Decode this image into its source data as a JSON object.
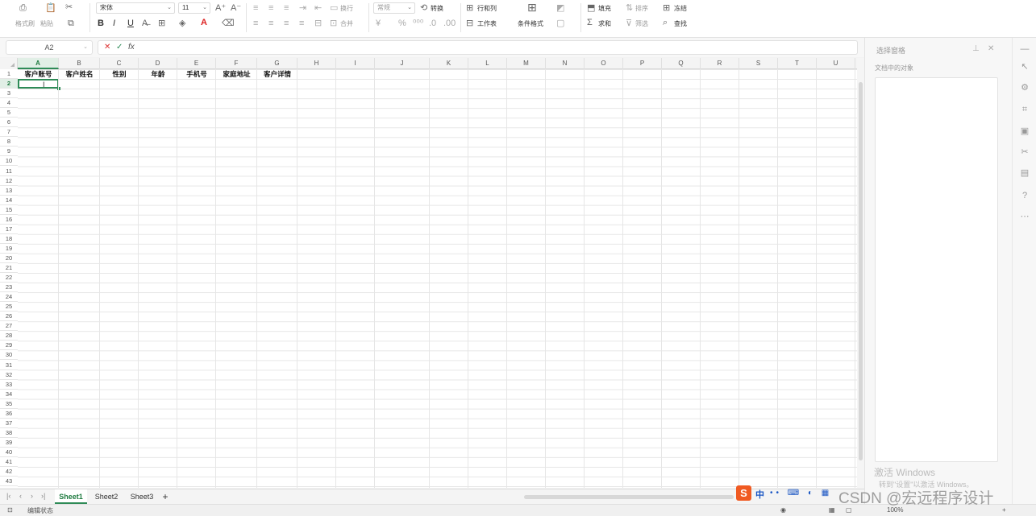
{
  "ribbon": {
    "clipboard": {
      "format_painter": "格式刷",
      "paste": "粘贴"
    },
    "font": {
      "name": "宋体",
      "size": "11",
      "bold": "B",
      "italic": "I",
      "underline": "U"
    },
    "alignment": {
      "wrap": "换行",
      "merge": "合并"
    },
    "number": {
      "format": "常规",
      "convert": "转换"
    },
    "cells": {
      "row_col": "行和列",
      "worksheet": "工作表",
      "conditional_format": "条件格式"
    },
    "editing": {
      "fill": "填充",
      "sort": "排序",
      "freeze": "冻结",
      "sum": "求和",
      "filter": "筛选",
      "find": "查找"
    }
  },
  "formula_bar": {
    "cell_ref": "A2",
    "fx": "fx",
    "cancel": "✕",
    "confirm": "✓"
  },
  "columns": [
    "A",
    "B",
    "C",
    "D",
    "E",
    "F",
    "G",
    "H",
    "I",
    "J",
    "K",
    "L",
    "M",
    "N",
    "O",
    "P",
    "Q",
    "R",
    "S",
    "T",
    "U"
  ],
  "rows": [
    "1",
    "2",
    "3",
    "4",
    "5",
    "6",
    "7",
    "8",
    "9",
    "10",
    "11",
    "12",
    "13",
    "14",
    "15",
    "16",
    "17",
    "18",
    "19",
    "20",
    "21",
    "22",
    "23",
    "24",
    "25",
    "26",
    "27",
    "28",
    "29",
    "30",
    "31",
    "32",
    "33",
    "34",
    "35",
    "36",
    "37",
    "38",
    "39",
    "40",
    "41",
    "42",
    "43"
  ],
  "header_row": [
    "客户账号",
    "客户姓名",
    "性别",
    "年龄",
    "手机号",
    "家庭地址",
    "客户详情"
  ],
  "sheets": [
    "Sheet1",
    "Sheet2",
    "Sheet3"
  ],
  "add_sheet": "+",
  "selection_pane": {
    "title": "选择窗格",
    "subtitle": "文档中的对象"
  },
  "status_bar": {
    "mode": "编辑状态",
    "zoom": "100%"
  },
  "overlay": {
    "activate_title": "激活 Windows",
    "activate_sub": "转到\"设置\"以激活 Windows。",
    "watermark": "CSDN @宏远程序设计",
    "ime_lang": "中"
  },
  "colors": {
    "accent": "#2e8b57",
    "ime": "#f05a22"
  }
}
